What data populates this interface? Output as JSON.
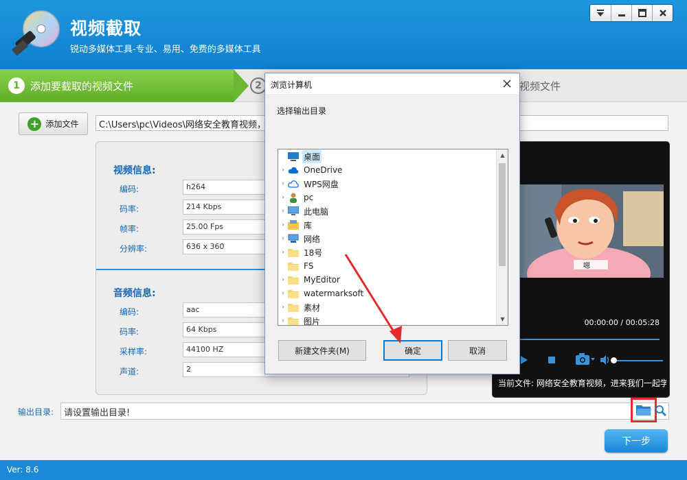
{
  "header": {
    "title": "视频截取",
    "subtitle": "锐动多媒体工具-专业、易用、免费的多媒体工具",
    "controls": [
      "menu-icon",
      "minimize-icon",
      "maximize-icon",
      "close-icon"
    ]
  },
  "steps": [
    {
      "num": "1",
      "label": "添加要截取的视频文件"
    },
    {
      "num": "2",
      "label": ""
    },
    {
      "label": "视频文件"
    }
  ],
  "add_file": {
    "label": "添加文件"
  },
  "source_path": "C:\\Users\\pc\\Videos\\网络安全教育视频，",
  "video_info": {
    "title": "视频信息:",
    "rows": [
      {
        "label": "编码:",
        "value": "h264"
      },
      {
        "label": "码率:",
        "value": "214 Kbps"
      },
      {
        "label": "帧率:",
        "value": "25.00 Fps"
      },
      {
        "label": "分辨率:",
        "value": "636 x 360"
      }
    ]
  },
  "audio_info": {
    "title": "音频信息:",
    "rows": [
      {
        "label": "编码:",
        "value": "aac"
      },
      {
        "label": "码率:",
        "value": "64 Kbps"
      },
      {
        "label": "采样率:",
        "value": "44100 HZ"
      },
      {
        "label": "声道:",
        "value": "2"
      }
    ]
  },
  "preview": {
    "subtitle_text": "嗯",
    "time": "00:00:00 / 00:05:28",
    "current_file": "当前文件: 网络安全教育视频，进来我们一起学"
  },
  "output": {
    "label": "输出目录:",
    "placeholder": "请设置输出目录!"
  },
  "next_button": "下一步",
  "version": "Ver: 8.6",
  "dialog": {
    "title": "浏览计算机",
    "prompt": "选择输出目录",
    "tree": [
      {
        "label": "桌面",
        "icon": "desktop-icon",
        "expander": "",
        "selected": true
      },
      {
        "label": "OneDrive",
        "icon": "cloud-icon",
        "expander": "›"
      },
      {
        "label": "WPS网盘",
        "icon": "cloud-outline-icon",
        "expander": "›"
      },
      {
        "label": "pc",
        "icon": "user-icon",
        "expander": "›"
      },
      {
        "label": "此电脑",
        "icon": "computer-icon",
        "expander": "›"
      },
      {
        "label": "库",
        "icon": "library-icon",
        "expander": "›"
      },
      {
        "label": "网络",
        "icon": "network-icon",
        "expander": "›"
      },
      {
        "label": "18号",
        "icon": "folder-icon",
        "expander": "›"
      },
      {
        "label": "FS",
        "icon": "folder-icon",
        "expander": ""
      },
      {
        "label": "MyEditor",
        "icon": "folder-icon",
        "expander": "›"
      },
      {
        "label": "watermarksoft",
        "icon": "folder-icon",
        "expander": "›"
      },
      {
        "label": "素材",
        "icon": "folder-icon",
        "expander": "›"
      },
      {
        "label": "图片",
        "icon": "folder-icon",
        "expander": "›"
      }
    ],
    "new_folder": "新建文件夹(M)",
    "ok": "确定",
    "cancel": "取消"
  },
  "colors": {
    "header": "#1a8ad8",
    "step_active": "#6bb832",
    "accent": "#1567b8",
    "highlight": "#e52a2a"
  }
}
